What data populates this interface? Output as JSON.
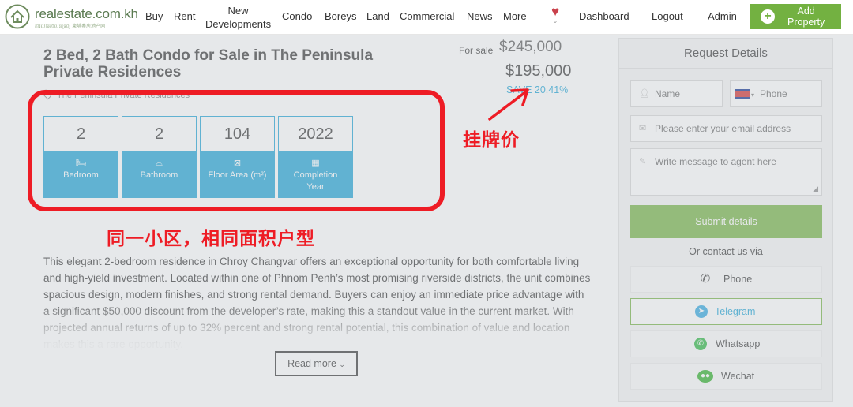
{
  "nav": {
    "logo_name": "realestate.com.kh",
    "logo_sub": "ការលក់អចលនទ្រព្យ  柬埔寨房地产网",
    "links": [
      "Buy",
      "Rent",
      "New",
      "Developments",
      "Condo",
      "Boreys",
      "Land",
      "Commercial",
      "News",
      "More"
    ],
    "dashboard": "Dashboard",
    "logout": "Logout",
    "admin": "Admin",
    "add_property": "Add Property",
    "add_property_lines": [
      "Add",
      "Property"
    ]
  },
  "listing": {
    "title": "2 Bed, 2 Bath Condo for Sale in The Peninsula Private Residences",
    "location": "The Peninsula Private Residences",
    "for_sale_label": "For sale",
    "old_price": "$245,000",
    "new_price": "$195,000",
    "save": "SAVE 20.41%",
    "stats": [
      {
        "value": "2",
        "label": "Bedroom",
        "icon": "bed-icon"
      },
      {
        "value": "2",
        "label": "Bathroom",
        "icon": "bathtub-icon"
      },
      {
        "value": "104",
        "label": "Floor Area (m²)",
        "icon": "floor-area-icon"
      },
      {
        "value": "2022",
        "label": "Completion Year",
        "icon": "calendar-icon"
      }
    ],
    "description": "This elegant 2-bedroom residence in Chroy Changvar offers an exceptional opportunity for both comfortable living and high-yield investment. Located within one of Phnom Penh’s most promising riverside districts, the unit combines spacious design, modern finishes, and strong rental demand. Buyers can enjoy an immediate price advantage with a significant $50,000 discount from the developer’s rate, making this a standout value in the current market. With projected annual returns of up to 32% percent and strong rental potential, this combination of value and location makes this a rare opportunity.",
    "read_more": "Read more"
  },
  "annotations": {
    "listing_price": "挂牌价",
    "same_unit": "同一小区，相同面积户型",
    "color": "#ee1c25"
  },
  "sidebar": {
    "title": "Request Details",
    "name_placeholder": "Name",
    "phone_placeholder": "Phone",
    "email_placeholder": "Please enter your email address",
    "message_placeholder": "Write message to agent here",
    "submit": "Submit details",
    "or_contact": "Or contact us via",
    "contacts": [
      {
        "label": "Phone",
        "icon": "phone-icon"
      },
      {
        "label": "Telegram",
        "icon": "telegram-icon"
      },
      {
        "label": "Whatsapp",
        "icon": "whatsapp-icon"
      },
      {
        "label": "Wechat",
        "icon": "wechat-icon"
      }
    ]
  },
  "colors": {
    "brand_green": "#73b141",
    "accent_blue": "#1aa3d6",
    "heart_red": "#c9414b"
  }
}
